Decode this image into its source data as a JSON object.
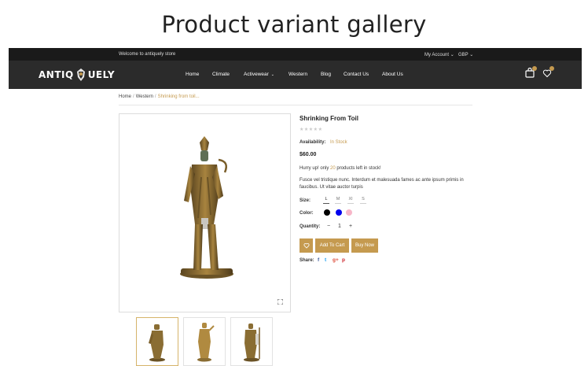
{
  "banner": {
    "title": "Product variant gallery"
  },
  "topbar": {
    "welcome": "Welcome to antiquely store",
    "account": "My Account",
    "currency": "GBP"
  },
  "header": {
    "logo": {
      "left": "ANTIQ",
      "right": "UELY"
    },
    "nav": [
      {
        "label": "Home",
        "dropdown": false
      },
      {
        "label": "Climate",
        "dropdown": false
      },
      {
        "label": "Activewear",
        "dropdown": true
      },
      {
        "label": "Western",
        "dropdown": false
      },
      {
        "label": "Blog",
        "dropdown": false
      },
      {
        "label": "Contact Us",
        "dropdown": false
      },
      {
        "label": "About Us",
        "dropdown": false
      }
    ],
    "icons": [
      "cart-icon",
      "wishlist-heart-icon"
    ]
  },
  "breadcrumb": {
    "home": "Home",
    "category": "Western",
    "current": "Shrinking from toil..."
  },
  "product": {
    "title": "Shrinking From Toil",
    "rating": 0,
    "rating_max": 5,
    "availability_label": "Availability:",
    "availability": "In Stock",
    "price": "$60.00",
    "stock_before": "Hurry up! only ",
    "stock_count": "20",
    "stock_after": " products left in stock!",
    "description": "Fusce vel tristique nunc. Interdum et malesuada fames ac ante ipsum primis in faucibus. Ut vitae auctor turpis",
    "size_label": "Size:",
    "sizes": [
      "L",
      "M",
      "Xl",
      "S"
    ],
    "selected_size": "L",
    "color_label": "Color:",
    "colors": [
      "#000000",
      "#0000ee",
      "#f7b6c8"
    ],
    "quantity_label": "Quantity:",
    "quantity": "1",
    "qty_minus": "−",
    "qty_plus": "+",
    "add_to_cart": "Add To Cart",
    "buy_now": "Buy Now",
    "share_label": "Share:",
    "share": [
      {
        "glyph": "f",
        "color": "#3b5998",
        "name": "facebook-icon"
      },
      {
        "glyph": "t",
        "color": "#1da1f2",
        "name": "twitter-icon"
      },
      {
        "glyph": "g+",
        "color": "#dd4b39",
        "name": "google-plus-icon"
      },
      {
        "glyph": "p",
        "color": "#cb2027",
        "name": "pinterest-icon"
      }
    ]
  },
  "gallery": {
    "thumbnail_count": 3,
    "active_index": 0
  },
  "colors": {
    "accent": "#c59a4f",
    "dark": "#2b2b2b",
    "topbar": "#1a1a1a"
  }
}
